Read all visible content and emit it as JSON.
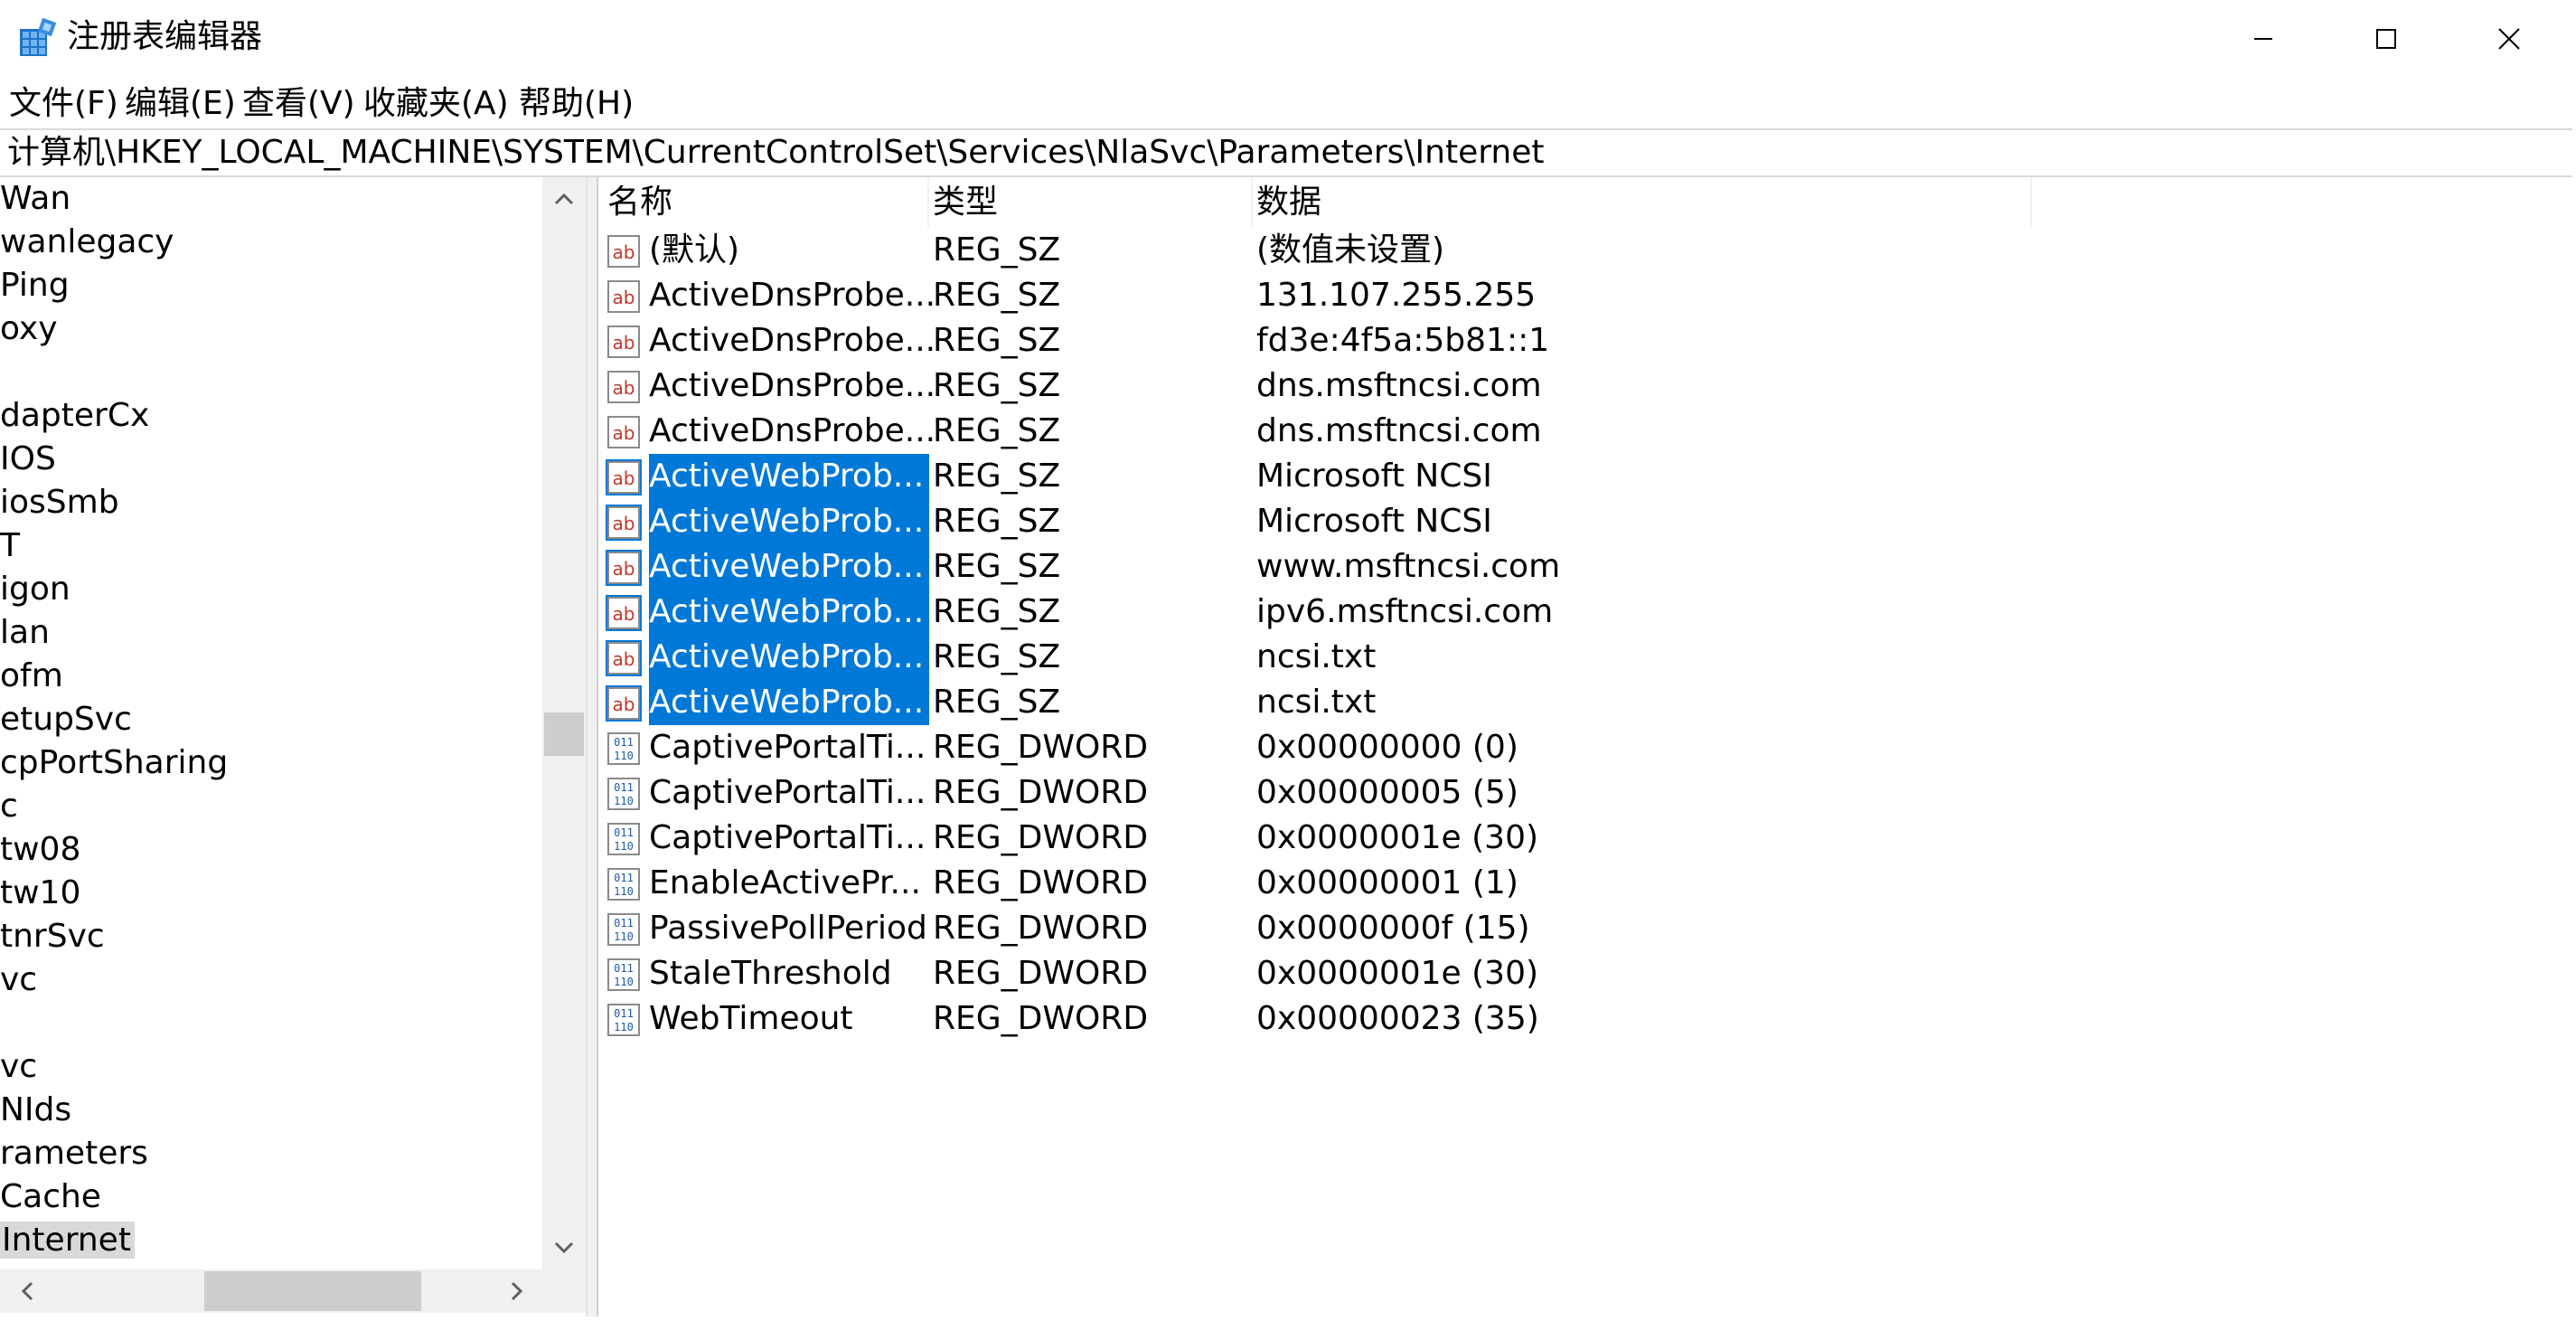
{
  "window": {
    "title": "注册表编辑器",
    "icon": "regedit-icon"
  },
  "menu": [
    {
      "label": "文件(F)"
    },
    {
      "label": "编辑(E)"
    },
    {
      "label": "查看(V)"
    },
    {
      "label": "收藏夹(A)"
    },
    {
      "label": "帮助(H)"
    }
  ],
  "address": {
    "path": "计算机\\HKEY_LOCAL_MACHINE\\SYSTEM\\CurrentControlSet\\Services\\NlaSvc\\Parameters\\Internet"
  },
  "tree": {
    "items": [
      {
        "label": "Wan"
      },
      {
        "label": "wanlegacy"
      },
      {
        "label": "Ping"
      },
      {
        "label": "oxy"
      },
      {
        "label": ""
      },
      {
        "label": "dapterCx"
      },
      {
        "label": "IOS"
      },
      {
        "label": "iosSmb"
      },
      {
        "label": "T"
      },
      {
        "label": "igon"
      },
      {
        "label": "lan"
      },
      {
        "label": "ofm"
      },
      {
        "label": "etupSvc"
      },
      {
        "label": "cpPortSharing"
      },
      {
        "label": "c"
      },
      {
        "label": "tw08"
      },
      {
        "label": "tw10"
      },
      {
        "label": "tnrSvc"
      },
      {
        "label": "vc"
      },
      {
        "label": ""
      },
      {
        "label": "vc"
      },
      {
        "label": "NIds"
      },
      {
        "label": "rameters"
      },
      {
        "label": "Cache"
      },
      {
        "label": "Internet",
        "selected": true
      }
    ]
  },
  "list": {
    "headers": {
      "name": "名称",
      "type": "类型",
      "data": "数据"
    },
    "rows": [
      {
        "icon": "string-value-icon",
        "name": "(默认)",
        "type": "REG_SZ",
        "data": "(数值未设置)",
        "selected": false
      },
      {
        "icon": "string-value-icon",
        "name": "ActiveDnsProbe...",
        "type": "REG_SZ",
        "data": "131.107.255.255",
        "selected": false
      },
      {
        "icon": "string-value-icon",
        "name": "ActiveDnsProbe...",
        "type": "REG_SZ",
        "data": "fd3e:4f5a:5b81::1",
        "selected": false
      },
      {
        "icon": "string-value-icon",
        "name": "ActiveDnsProbe...",
        "type": "REG_SZ",
        "data": "dns.msftncsi.com",
        "selected": false
      },
      {
        "icon": "string-value-icon",
        "name": "ActiveDnsProbe...",
        "type": "REG_SZ",
        "data": "dns.msftncsi.com",
        "selected": false
      },
      {
        "icon": "string-value-icon",
        "name": "ActiveWebProb...",
        "type": "REG_SZ",
        "data": "Microsoft NCSI",
        "selected": true
      },
      {
        "icon": "string-value-icon",
        "name": "ActiveWebProb...",
        "type": "REG_SZ",
        "data": "Microsoft NCSI",
        "selected": true
      },
      {
        "icon": "string-value-icon",
        "name": "ActiveWebProb...",
        "type": "REG_SZ",
        "data": "www.msftncsi.com",
        "selected": true
      },
      {
        "icon": "string-value-icon",
        "name": "ActiveWebProb...",
        "type": "REG_SZ",
        "data": "ipv6.msftncsi.com",
        "selected": true
      },
      {
        "icon": "string-value-icon",
        "name": "ActiveWebProb...",
        "type": "REG_SZ",
        "data": "ncsi.txt",
        "selected": true
      },
      {
        "icon": "string-value-icon",
        "name": "ActiveWebProb...",
        "type": "REG_SZ",
        "data": "ncsi.txt",
        "selected": true
      },
      {
        "icon": "dword-value-icon",
        "name": "CaptivePortalTi...",
        "type": "REG_DWORD",
        "data": "0x00000000 (0)",
        "selected": false
      },
      {
        "icon": "dword-value-icon",
        "name": "CaptivePortalTi...",
        "type": "REG_DWORD",
        "data": "0x00000005 (5)",
        "selected": false
      },
      {
        "icon": "dword-value-icon",
        "name": "CaptivePortalTi...",
        "type": "REG_DWORD",
        "data": "0x0000001e (30)",
        "selected": false
      },
      {
        "icon": "dword-value-icon",
        "name": "EnableActivePr...",
        "type": "REG_DWORD",
        "data": "0x00000001 (1)",
        "selected": false
      },
      {
        "icon": "dword-value-icon",
        "name": "PassivePollPeriod",
        "type": "REG_DWORD",
        "data": "0x0000000f (15)",
        "selected": false
      },
      {
        "icon": "dword-value-icon",
        "name": "StaleThreshold",
        "type": "REG_DWORD",
        "data": "0x0000001e (30)",
        "selected": false
      },
      {
        "icon": "dword-value-icon",
        "name": "WebTimeout",
        "type": "REG_DWORD",
        "data": "0x00000023 (35)",
        "selected": false
      }
    ]
  },
  "colors": {
    "selection": "#0078d7",
    "tree_selection": "#d9d9d9",
    "scrollbar_track": "#f0f0f0",
    "scrollbar_thumb": "#cdcdcd"
  }
}
